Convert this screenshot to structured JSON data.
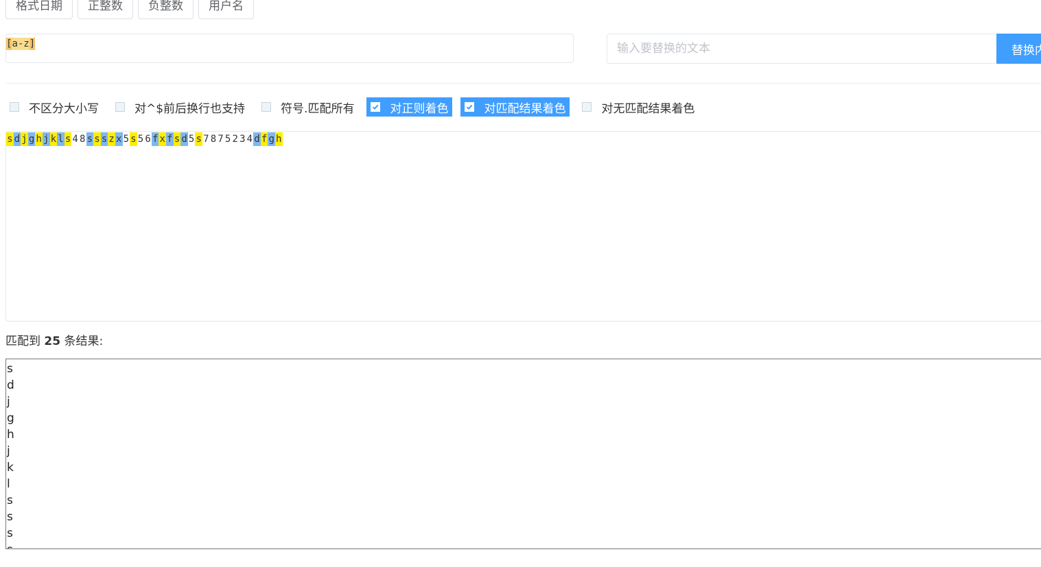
{
  "presets": [
    "格式日期",
    "正整数",
    "负整数",
    "用户名"
  ],
  "regex": {
    "open": "[",
    "range": "a-z",
    "close": "]"
  },
  "replace": {
    "placeholder": "输入要替换的文本",
    "button_label": "替换内容"
  },
  "options": [
    {
      "label": "不区分大小写",
      "checked": false
    },
    {
      "label": "对^$前后换行也支持",
      "checked": false
    },
    {
      "label": "符号.匹配所有",
      "checked": false
    },
    {
      "label": "对正则着色",
      "checked": true
    },
    {
      "label": "对匹配结果着色",
      "checked": true
    },
    {
      "label": "对无匹配结果着色",
      "checked": false
    }
  ],
  "sample_text": [
    {
      "c": "s",
      "h": "y"
    },
    {
      "c": "d",
      "h": "b"
    },
    {
      "c": "j",
      "h": "y"
    },
    {
      "c": "g",
      "h": "b"
    },
    {
      "c": "h",
      "h": "y"
    },
    {
      "c": "j",
      "h": "b"
    },
    {
      "c": "k",
      "h": "y"
    },
    {
      "c": "l",
      "h": "b"
    },
    {
      "c": "s",
      "h": "y"
    },
    {
      "c": "4",
      "h": ""
    },
    {
      "c": "8",
      "h": ""
    },
    {
      "c": "s",
      "h": "b"
    },
    {
      "c": "s",
      "h": "y"
    },
    {
      "c": "s",
      "h": "b"
    },
    {
      "c": "z",
      "h": "y"
    },
    {
      "c": "x",
      "h": "b"
    },
    {
      "c": "5",
      "h": ""
    },
    {
      "c": "s",
      "h": "y"
    },
    {
      "c": "5",
      "h": ""
    },
    {
      "c": "6",
      "h": ""
    },
    {
      "c": "f",
      "h": "b"
    },
    {
      "c": "x",
      "h": "y"
    },
    {
      "c": "f",
      "h": "b"
    },
    {
      "c": "s",
      "h": "y"
    },
    {
      "c": "d",
      "h": "b"
    },
    {
      "c": "5",
      "h": ""
    },
    {
      "c": "s",
      "h": "y"
    },
    {
      "c": "7",
      "h": ""
    },
    {
      "c": "8",
      "h": ""
    },
    {
      "c": "7",
      "h": ""
    },
    {
      "c": "5",
      "h": ""
    },
    {
      "c": "2",
      "h": ""
    },
    {
      "c": "3",
      "h": ""
    },
    {
      "c": "4",
      "h": ""
    },
    {
      "c": "d",
      "h": "b"
    },
    {
      "c": "f",
      "h": "y"
    },
    {
      "c": "g",
      "h": "b"
    },
    {
      "c": "h",
      "h": "y"
    }
  ],
  "result": {
    "prefix": "匹配到 ",
    "count": "25",
    "suffix": " 条结果:"
  },
  "matches": [
    "s",
    "d",
    "j",
    "g",
    "h",
    "j",
    "k",
    "l",
    "s",
    "s",
    "s",
    "s"
  ],
  "colors": {
    "accent": "#409eff",
    "match_yellow": "#ffed00",
    "match_blue": "#7fb7f0",
    "regex_highlight": "#f6c46b"
  }
}
